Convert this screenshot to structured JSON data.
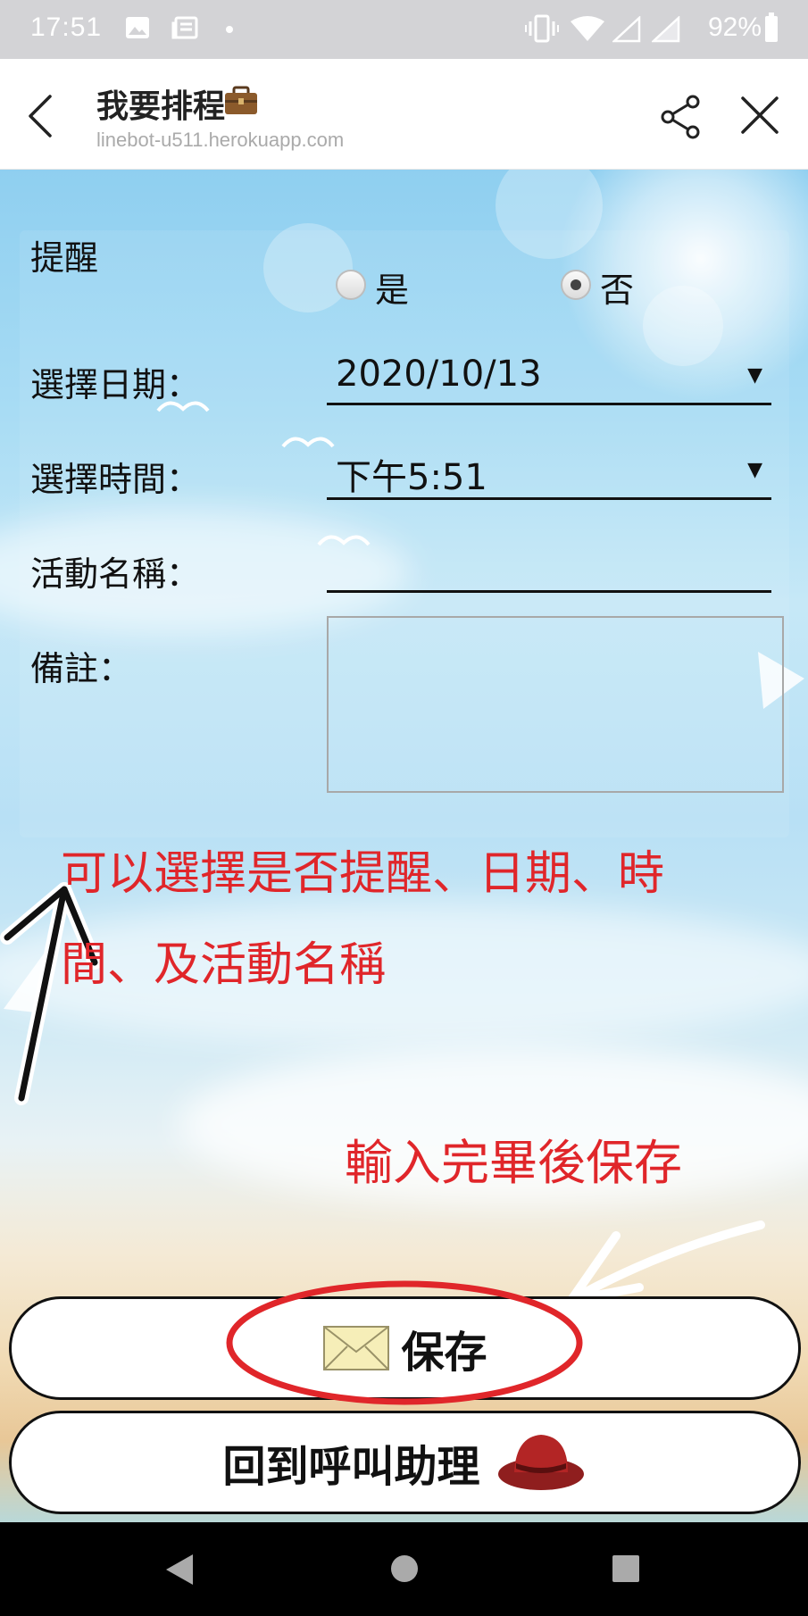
{
  "status_bar": {
    "time": "17:51",
    "battery": "92%",
    "icons": [
      "image-icon",
      "news-icon",
      "dot-icon",
      "vibrate-icon",
      "wifi-icon",
      "signal-icon",
      "signal-icon",
      "battery-icon"
    ]
  },
  "header": {
    "title": "我要排程",
    "url": "linebot-u511.herokuapp.com",
    "icons": [
      "back-arrow-icon",
      "briefcase-icon",
      "share-icon",
      "close-icon"
    ]
  },
  "form": {
    "reminder_label": "提醒",
    "reminder_options": [
      {
        "label": "是",
        "checked": false
      },
      {
        "label": "否",
        "checked": true
      }
    ],
    "date_label": "選擇日期：",
    "date_value": "2020/10/13",
    "time_label": "選擇時間：",
    "time_value": "下午5:51",
    "activity_label": "活動名稱：",
    "activity_value": "",
    "note_label": "備註：",
    "note_value": "",
    "dropdown_arrow": "▼"
  },
  "annotations": {
    "line1": "可以選擇是否提醒、日期、時",
    "line2": "間、及活動名稱",
    "save_hint": "輸入完畢後保存",
    "color": "#e0262a"
  },
  "buttons": {
    "save_label": "保存",
    "back_label": "回到呼叫助理",
    "icons": [
      "envelope-icon",
      "hat-icon"
    ]
  },
  "nav_bar": {
    "icons": [
      "nav-back-icon",
      "nav-home-icon",
      "nav-recents-icon"
    ]
  }
}
